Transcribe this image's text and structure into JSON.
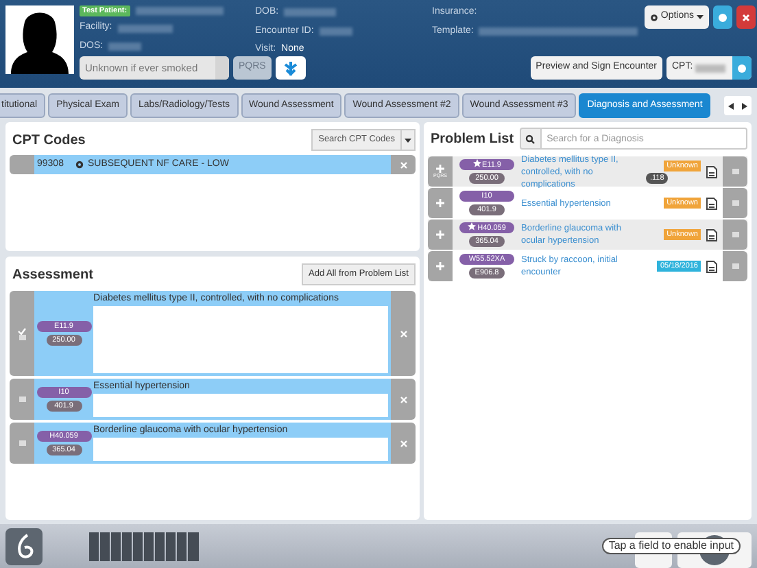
{
  "patient": {
    "badge": "Test Patient:",
    "labels": [
      "Facility:",
      "DOS:"
    ],
    "col2": [
      {
        "label": "DOB:"
      },
      {
        "label": "Encounter ID:"
      },
      {
        "label": "Visit:",
        "value": "None"
      }
    ],
    "col3": [
      "Insurance:",
      "Template:"
    ]
  },
  "header_buttons": {
    "options": "Options",
    "smoking": "Unknown if ever smoked",
    "pqrs": "PQRS",
    "preview": "Preview and Sign Encounter",
    "cpt": "CPT:"
  },
  "tabs": [
    {
      "label": "titutional",
      "selected": false
    },
    {
      "label": "Physical Exam",
      "selected": false
    },
    {
      "label": "Labs/Radiology/Tests",
      "selected": false
    },
    {
      "label": "Wound Assessment",
      "selected": false
    },
    {
      "label": "Wound Assessment #2",
      "selected": false
    },
    {
      "label": "Wound Assessment #3",
      "selected": false
    },
    {
      "label": "Diagnosis and Assessment",
      "selected": true
    }
  ],
  "cpt_codes": {
    "title": "CPT Codes",
    "search_button": "Search CPT Codes",
    "rows": [
      {
        "code": "99308",
        "description": "SUBSEQUENT NF CARE - LOW",
        "selected": true
      }
    ]
  },
  "assessment": {
    "title": "Assessment",
    "add_button": "Add All from Problem List",
    "rows": [
      {
        "icd10": "E11.9",
        "icd9": "250.00",
        "description": "Diabetes mellitus type II, controlled, with no complications",
        "checked": true,
        "expanded": true
      },
      {
        "icd10": "I10",
        "icd9": "401.9",
        "description": "Essential hypertension",
        "checked": false,
        "expanded": false
      },
      {
        "icd10": "H40.059",
        "icd9": "365.04",
        "description": "Borderline glaucoma with ocular hypertension",
        "checked": false,
        "expanded": false
      }
    ]
  },
  "problem_list": {
    "title": "Problem List",
    "search": {
      "placeholder": "Search for a Diagnosis"
    },
    "items": [
      {
        "icd10": "E11.9",
        "starred": true,
        "icd9": "250.00",
        "description": "Diabetes mellitus type II, controlled, with no complications",
        "status": "Unknown",
        "color": "#f0a43a",
        "extra": ".118",
        "pqrs": "PQRS",
        "shaded": true
      },
      {
        "icd10": "I10",
        "starred": false,
        "icd9": "401.9",
        "description": "Essential hypertension",
        "status": "Unknown",
        "color": "#f0a43a",
        "shaded": false
      },
      {
        "icd10": "H40.059",
        "starred": true,
        "icd9": "365.04",
        "description": "Borderline glaucoma with ocular hypertension",
        "status": "Unknown",
        "color": "#f0a43a",
        "shaded": true
      },
      {
        "icd10": "W55.52XA",
        "starred": false,
        "icd9": "E906.8",
        "description": "Struck by raccoon, initial encounter",
        "status": "05/18/2016",
        "color": "#2fb3dc",
        "shaded": false
      }
    ]
  },
  "toast": "Tap a field to enable input"
}
